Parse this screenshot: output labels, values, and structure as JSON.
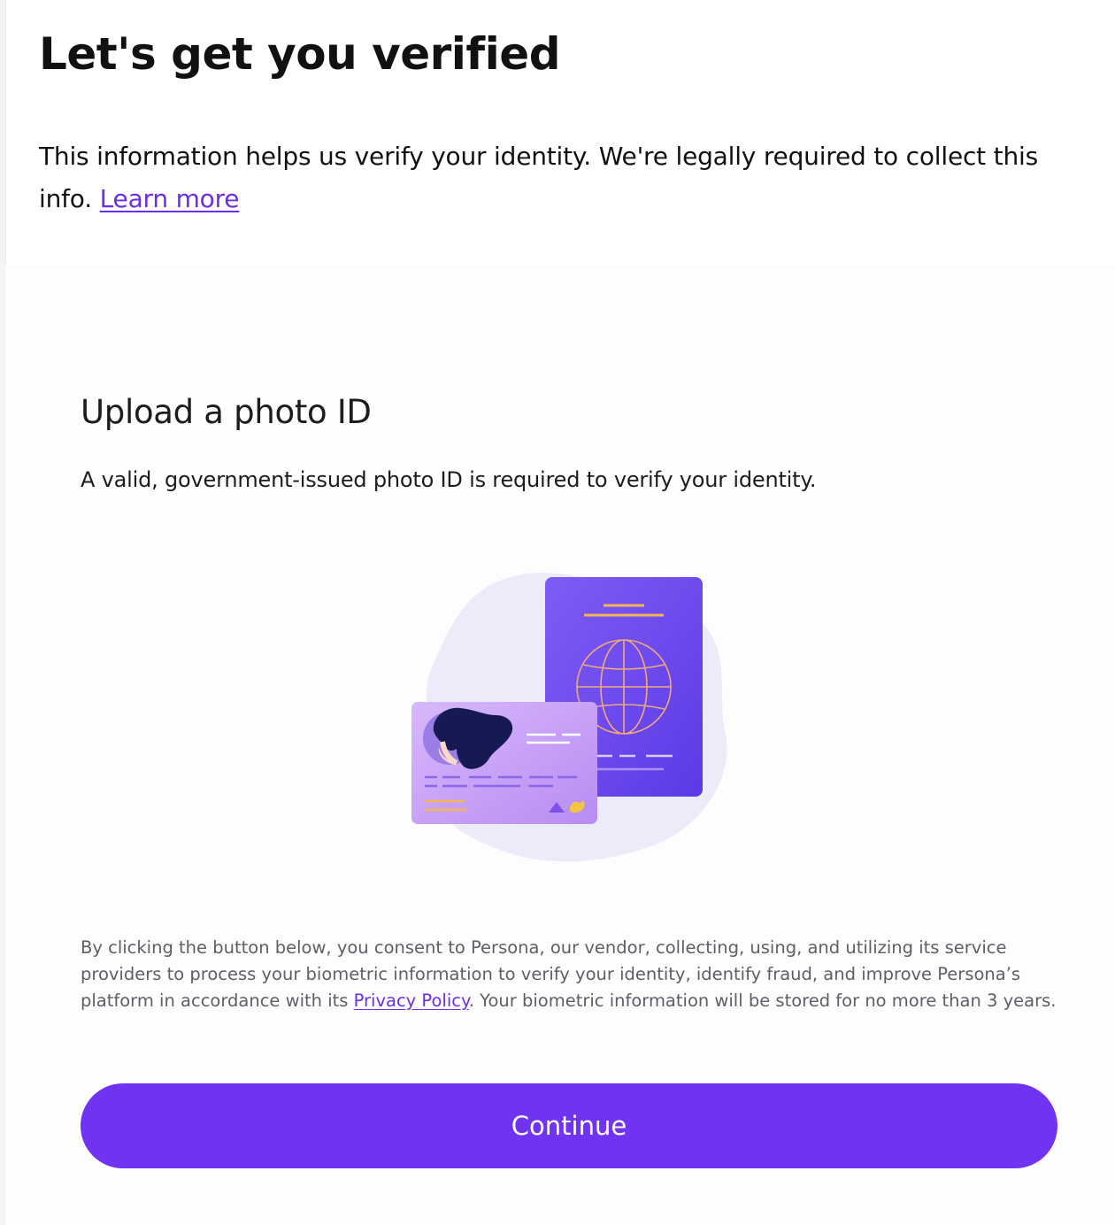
{
  "header": {
    "title": "Let's get you verified",
    "intro_text": "This information helps us verify your identity. We're legally required to collect this info.",
    "learn_more_link": "Learn more"
  },
  "upload": {
    "title": "Upload a photo ID",
    "description": "A valid, government-issued photo ID is required to verify your identity.",
    "illustration_icon": "id-card-and-passport-icon"
  },
  "consent": {
    "text_before_link": "By clicking the button below, you consent to Persona, our vendor, collecting, using, and utilizing its service providers to process your biometric information to verify your identity, identify fraud, and improve Persona’s platform in accordance with its",
    "privacy_link": "Privacy Policy",
    "text_after_link": ". Your biometric information will be stored for no more than 3 years."
  },
  "actions": {
    "continue_label": "Continue"
  },
  "colors": {
    "accent": "#7133f2",
    "link": "#6b2ee8",
    "passport": "#6a45ef",
    "card": "#c6a1f7"
  }
}
